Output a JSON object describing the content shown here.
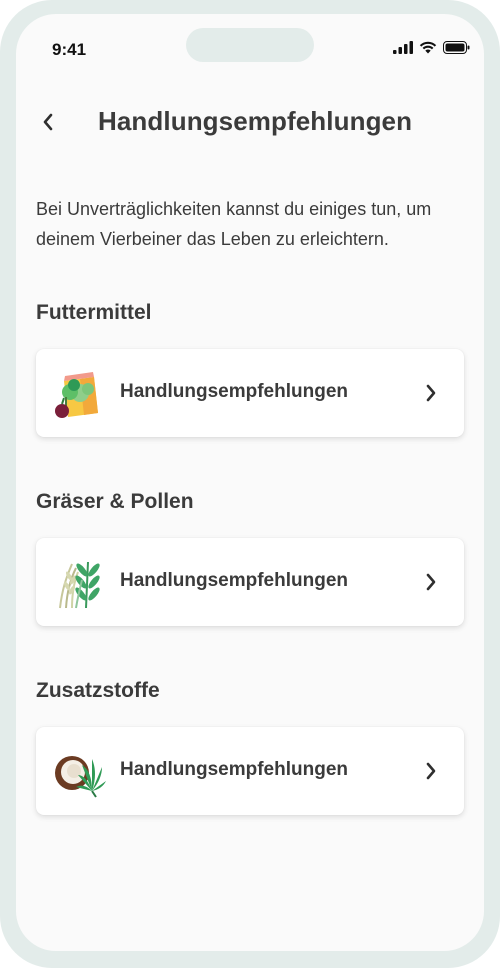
{
  "status_bar": {
    "time": "9:41"
  },
  "header": {
    "title": "Handlungsempfehlungen"
  },
  "intro_text": "Bei Unverträglichkeiten kannst du einiges tun, um deinem Vierbeiner das Leben zu erleichtern.",
  "sections": [
    {
      "title": "Futtermittel",
      "card_label": "Handlungsempfehlungen",
      "icon": "food-bag-icon"
    },
    {
      "title": "Gräser & Pollen",
      "card_label": "Handlungsempfehlungen",
      "icon": "grass-icon"
    },
    {
      "title": "Zusatzstoffe",
      "card_label": "Handlungsempfehlungen",
      "icon": "coconut-leaf-icon"
    }
  ],
  "colors": {
    "frame": "#e3ecea",
    "screen_bg": "#fafafa",
    "text": "#3b3b3b",
    "card_bg": "#ffffff"
  }
}
